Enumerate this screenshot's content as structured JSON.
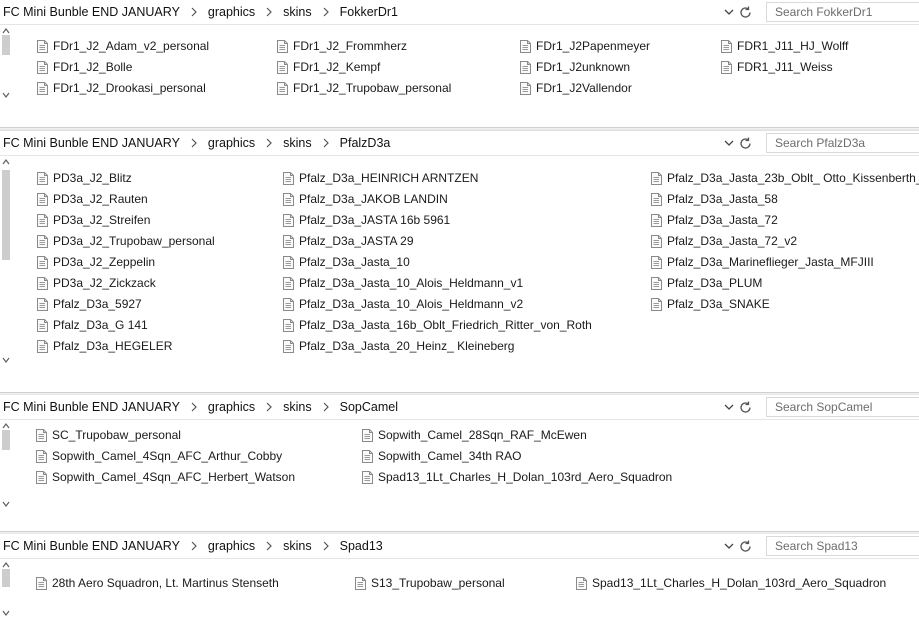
{
  "search_placeholder_prefix": "Search",
  "panes": [
    {
      "breadcrumb": [
        "FC Mini Bunble END JANUARY",
        "graphics",
        "skins",
        "FokkerDr1"
      ],
      "search_placeholder": "Search FokkerDr1",
      "columns": [
        [
          "FDr1_J2_Adam_v2_personal",
          "FDr1_J2_Bolle",
          "FDr1_J2_Drookasi_personal"
        ],
        [
          "FDr1_J2_Frommherz",
          "FDr1_J2_Kempf",
          "FDr1_J2_Trupobaw_personal"
        ],
        [
          "FDr1_J2Papenmeyer",
          "FDr1_J2unknown",
          "FDr1_J2Vallendor"
        ],
        [
          "FDR1_J11_HJ_Wolff",
          "FDR1_J11_Weiss"
        ]
      ]
    },
    {
      "breadcrumb": [
        "FC Mini Bunble END JANUARY",
        "graphics",
        "skins",
        "PfalzD3a"
      ],
      "search_placeholder": "Search PfalzD3a",
      "columns": [
        [
          "PD3a_J2_Blitz",
          "PD3a_J2_Rauten",
          "PD3a_J2_Streifen",
          "PD3a_J2_Trupobaw_personal",
          "PD3a_J2_Zeppelin",
          "PD3a_J2_Zickzack",
          "Pfalz_D3a_5927",
          "Pfalz_D3a_G 141",
          "Pfalz_D3a_HEGELER"
        ],
        [
          "Pfalz_D3a_HEINRICH ARNTZEN",
          "Pfalz_D3a_JAKOB LANDIN",
          "Pfalz_D3a_JASTA 16b 5961",
          "Pfalz_D3a_JASTA 29",
          "Pfalz_D3a_Jasta_10",
          "Pfalz_D3a_Jasta_10_Alois_Heldmann_v1",
          "Pfalz_D3a_Jasta_10_Alois_Heldmann_v2",
          "Pfalz_D3a_Jasta_16b_Oblt_Friedrich_Ritter_von_Roth",
          "Pfalz_D3a_Jasta_20_Heinz_ Kleineberg"
        ],
        [
          "Pfalz_D3a_Jasta_23b_Oblt_ Otto_Kissenberth_2",
          "Pfalz_D3a_Jasta_58",
          "Pfalz_D3a_Jasta_72",
          "Pfalz_D3a_Jasta_72_v2",
          "Pfalz_D3a_Marineflieger_Jasta_MFJIII",
          "Pfalz_D3a_PLUM",
          "Pfalz_D3a_SNAKE"
        ]
      ]
    },
    {
      "breadcrumb": [
        "FC Mini Bunble END JANUARY",
        "graphics",
        "skins",
        "SopCamel"
      ],
      "search_placeholder": "Search SopCamel",
      "columns": [
        [
          "SC_Trupobaw_personal",
          "Sopwith_Camel_4Sqn_AFC_Arthur_Cobby",
          "Sopwith_Camel_4Sqn_AFC_Herbert_Watson"
        ],
        [
          "Sopwith_Camel_28Sqn_RAF_McEwen",
          "Sopwith_Camel_34th RAO",
          "Spad13_1Lt_Charles_H_Dolan_103rd_Aero_Squadron"
        ]
      ]
    },
    {
      "breadcrumb": [
        "FC Mini Bunble END JANUARY",
        "graphics",
        "skins",
        "Spad13"
      ],
      "search_placeholder": "Search Spad13",
      "columns": [
        [
          "28th Aero Squadron, Lt. Martinus Stenseth"
        ],
        [
          "S13_Trupobaw_personal"
        ],
        [
          "Spad13_1Lt_Charles_H_Dolan_103rd_Aero_Squadron"
        ]
      ]
    }
  ],
  "colors": {
    "scroll_thumb": "#cdcdcd",
    "search_text": "#6d6d6d",
    "divider": "#dcdcdc"
  },
  "icons": {
    "file": "file-icon",
    "breadcrumb_separator": "chevron-right-icon",
    "dropdown": "chevron-down-icon",
    "refresh": "refresh-icon",
    "scroll_up": "scroll-up-arrow-icon",
    "scroll_down": "scroll-down-arrow-icon"
  }
}
